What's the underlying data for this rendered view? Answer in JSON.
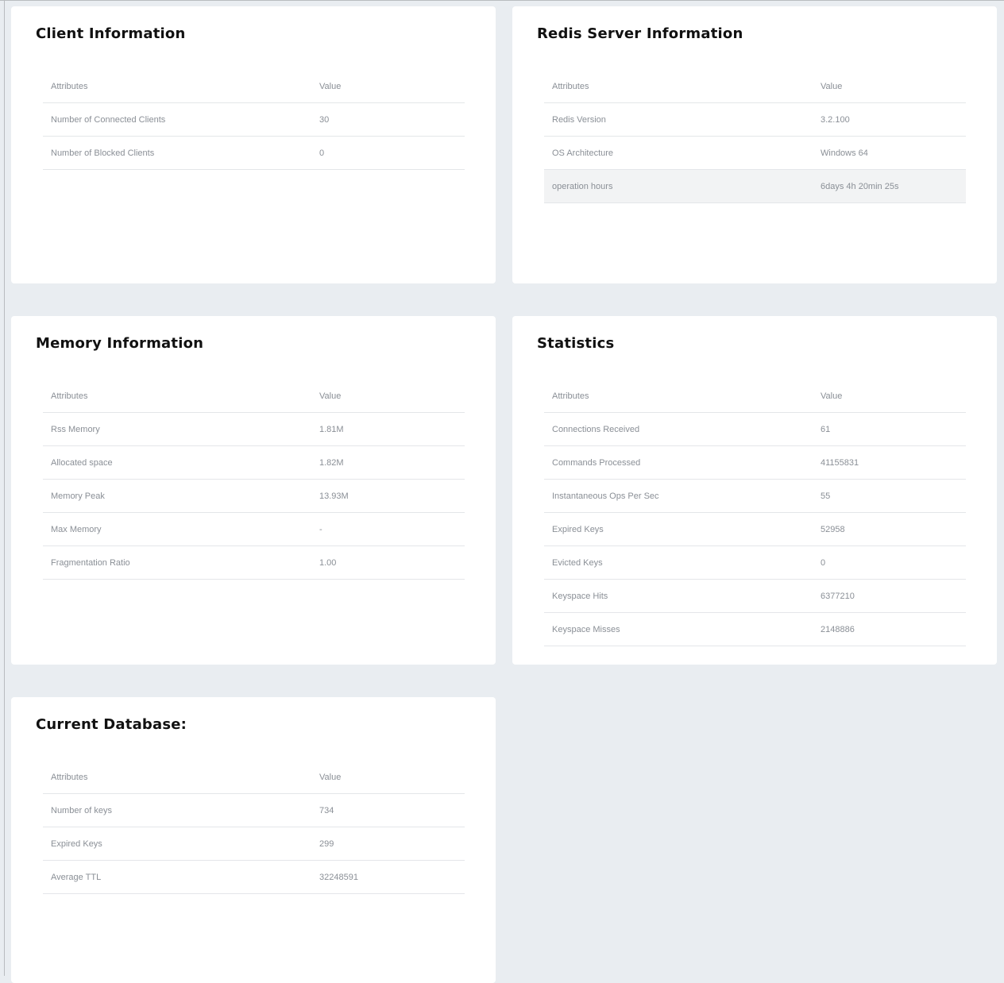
{
  "client_info": {
    "title": "Client Information",
    "headers": [
      "Attributes",
      "Value"
    ],
    "rows": [
      {
        "attr": "Number of Connected Clients",
        "value": "30"
      },
      {
        "attr": "Number of Blocked Clients",
        "value": "0"
      }
    ]
  },
  "server_info": {
    "title": "Redis Server Information",
    "headers": [
      "Attributes",
      "Value"
    ],
    "rows": [
      {
        "attr": "Redis Version",
        "value": "3.2.100"
      },
      {
        "attr": "OS Architecture",
        "value": "Windows 64"
      },
      {
        "attr": "operation hours",
        "value": "6days 4h 20min 25s"
      }
    ]
  },
  "memory_info": {
    "title": "Memory Information",
    "headers": [
      "Attributes",
      "Value"
    ],
    "rows": [
      {
        "attr": "Rss Memory",
        "value": "1.81M"
      },
      {
        "attr": "Allocated space",
        "value": "1.82M"
      },
      {
        "attr": "Memory Peak",
        "value": "13.93M"
      },
      {
        "attr": "Max Memory",
        "value": "-"
      },
      {
        "attr": "Fragmentation Ratio",
        "value": "1.00"
      }
    ]
  },
  "statistics": {
    "title": "Statistics",
    "headers": [
      "Attributes",
      "Value"
    ],
    "rows": [
      {
        "attr": "Connections Received",
        "value": "61"
      },
      {
        "attr": "Commands Processed",
        "value": "41155831"
      },
      {
        "attr": "Instantaneous Ops Per Sec",
        "value": "55"
      },
      {
        "attr": "Expired Keys",
        "value": "52958"
      },
      {
        "attr": "Evicted Keys",
        "value": "0"
      },
      {
        "attr": "Keyspace Hits",
        "value": "6377210"
      },
      {
        "attr": "Keyspace Misses",
        "value": "2148886"
      }
    ]
  },
  "current_db": {
    "title": "Current Database:",
    "headers": [
      "Attributes",
      "Value"
    ],
    "rows": [
      {
        "attr": "Number of keys",
        "value": "734"
      },
      {
        "attr": "Expired Keys",
        "value": "299"
      },
      {
        "attr": "Average TTL",
        "value": "32248591"
      }
    ]
  },
  "colors": {
    "page_background": "#e9edf1",
    "card_background": "#ffffff",
    "title_text": "#111111",
    "table_text": "#8a8f96",
    "row_divider": "#e4e6e9",
    "row_highlight": "#f2f3f4"
  }
}
